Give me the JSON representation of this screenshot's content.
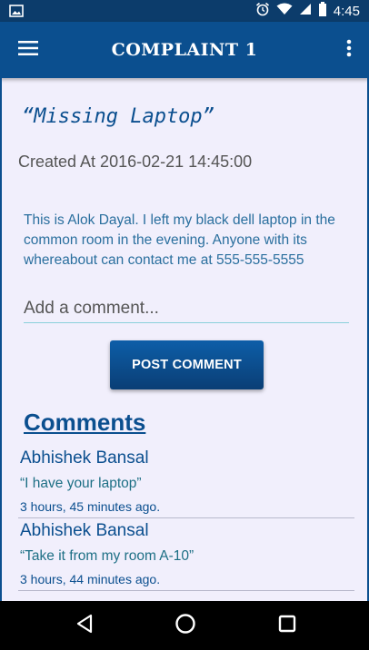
{
  "status_bar": {
    "time": "4:45",
    "icons": [
      "image-icon",
      "alarm-icon",
      "wifi-icon",
      "signal-icon",
      "battery-icon"
    ]
  },
  "app_bar": {
    "title": "Complaint 1",
    "icons": [
      "menu-icon",
      "overflow-menu-icon"
    ]
  },
  "complaint": {
    "title": "“Missing Laptop”",
    "created_at": "Created At 2016-02-21 14:45:00",
    "description": "This is Alok Dayal. I left my black dell laptop in the common room in the evening. Anyone with its whereabout can contact me at 555-555-5555"
  },
  "comment_form": {
    "placeholder": "Add a comment...",
    "value": "",
    "post_label": "POST COMMENT"
  },
  "comments": {
    "heading": "Comments",
    "items": [
      {
        "author": "Abhishek Bansal",
        "text": "“I have your laptop”",
        "time": "3 hours, 45 minutes ago."
      },
      {
        "author": "Abhishek Bansal",
        "text": "“Take it from my room A-10”",
        "time": "3 hours, 44 minutes ago."
      }
    ]
  },
  "nav_bar": {
    "icons": [
      "back-icon",
      "home-icon",
      "recents-icon"
    ]
  },
  "colors": {
    "status_bar": "#0c3c6b",
    "app_bar": "#0b4f8f",
    "background": "#f1effc",
    "accent_text": "#2a6f9e"
  }
}
